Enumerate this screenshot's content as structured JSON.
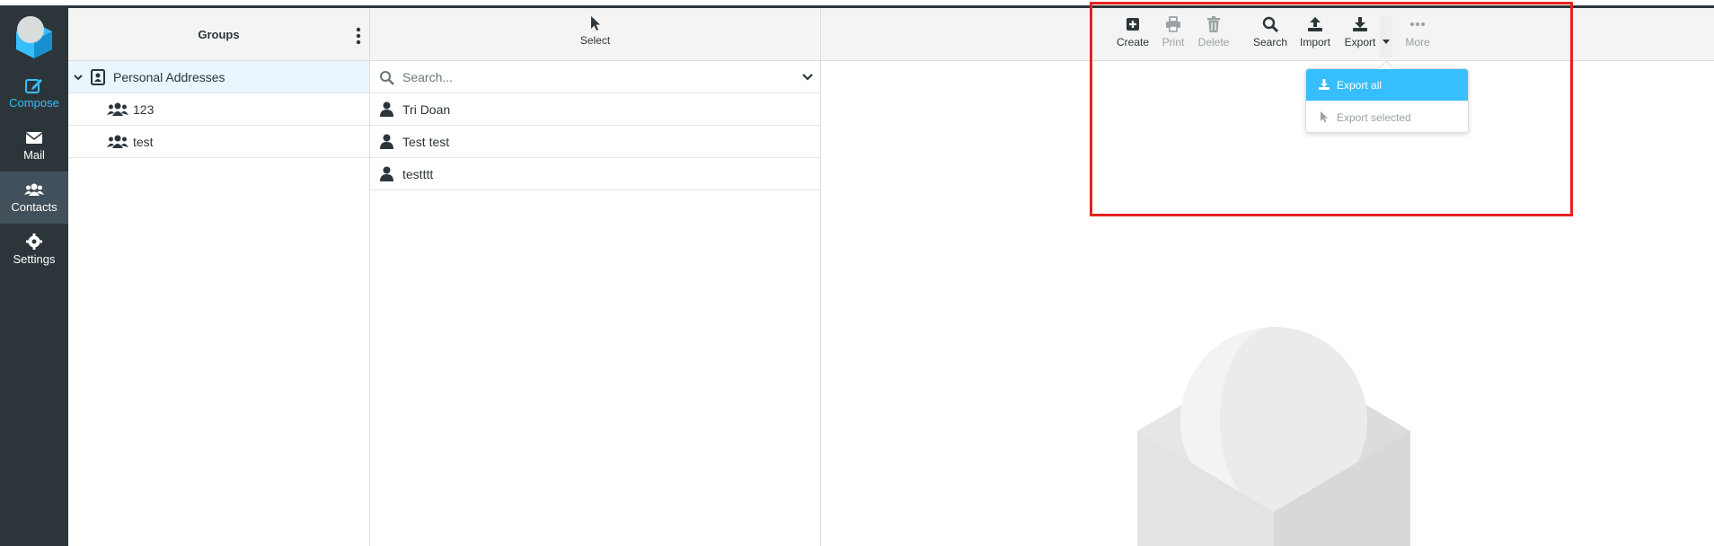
{
  "rail": {
    "items": [
      {
        "label": "Compose",
        "icon": "compose-icon"
      },
      {
        "label": "Mail",
        "icon": "envelope-icon"
      },
      {
        "label": "Contacts",
        "icon": "users-icon"
      },
      {
        "label": "Settings",
        "icon": "gear-icon"
      }
    ]
  },
  "groups": {
    "title": "Groups",
    "items": [
      {
        "label": "Personal Addresses",
        "icon": "address-book-icon"
      },
      {
        "label": "123",
        "icon": "users-icon"
      },
      {
        "label": "test",
        "icon": "users-icon"
      }
    ]
  },
  "list": {
    "select_label": "Select",
    "search_placeholder": "Search...",
    "contacts": [
      "Tri Doan",
      "Test test",
      "testttt"
    ]
  },
  "toolbar": {
    "create": "Create",
    "print": "Print",
    "delete": "Delete",
    "search": "Search",
    "import": "Import",
    "export": "Export",
    "more": "More"
  },
  "export_menu": {
    "export_all": "Export all",
    "export_selected": "Export selected"
  },
  "colors": {
    "rail_bg": "#2c363a",
    "accent": "#37beff",
    "highlight_box": "#e52222"
  }
}
